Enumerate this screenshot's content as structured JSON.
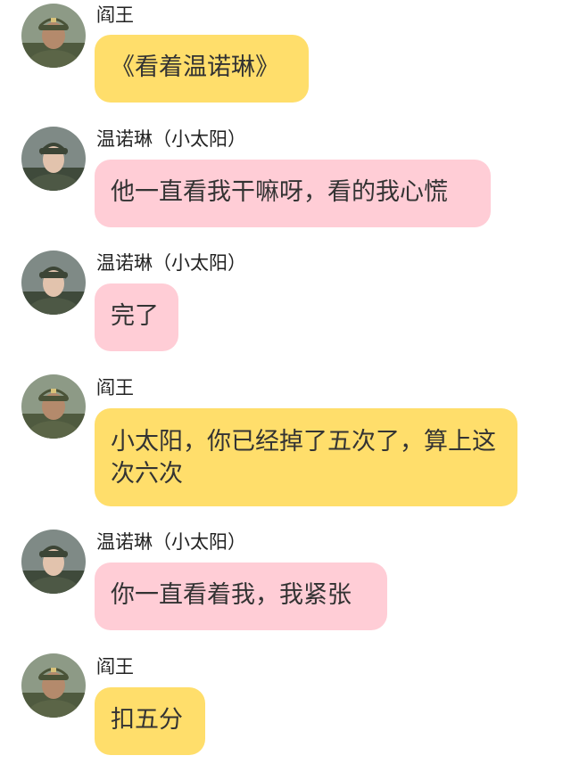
{
  "messages": [
    {
      "sender": "阎王",
      "text": "《看着温诺琳》",
      "avatar": "soldier-male-avatar",
      "bubble_color": "#FFDE6B"
    },
    {
      "sender": "温诺琳（小太阳）",
      "text": "他一直看我干嘛呀，看的我心慌",
      "avatar": "soldier-female-avatar",
      "bubble_color": "#FFCDD6"
    },
    {
      "sender": "温诺琳（小太阳）",
      "text": "完了",
      "avatar": "soldier-female-avatar",
      "bubble_color": "#FFCDD6"
    },
    {
      "sender": "阎王",
      "text": "小太阳，你已经掉了五次了，算上这次六次",
      "avatar": "soldier-male-avatar",
      "bubble_color": "#FFDE6B"
    },
    {
      "sender": "温诺琳（小太阳）",
      "text": "你一直看着我，我紧张",
      "avatar": "soldier-female-avatar",
      "bubble_color": "#FFCDD6"
    },
    {
      "sender": "阎王",
      "text": "扣五分",
      "avatar": "soldier-male-avatar",
      "bubble_color": "#FFDE6B"
    }
  ]
}
